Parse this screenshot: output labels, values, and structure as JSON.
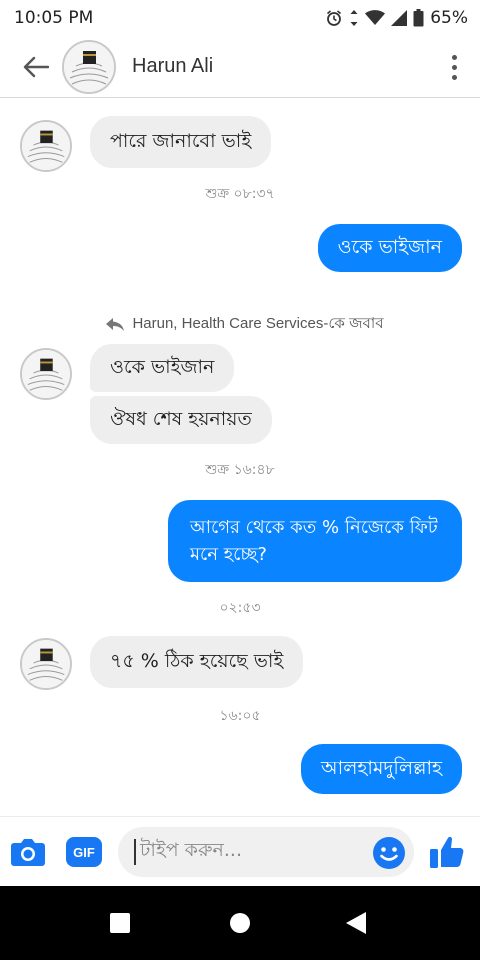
{
  "status_bar": {
    "time": "10:05 PM",
    "battery": "65%",
    "icons": [
      "alarm-icon",
      "data-arrows-icon",
      "wifi-icon",
      "signal-icon",
      "battery-icon"
    ]
  },
  "header": {
    "contact_name": "Harun Ali",
    "back_icon": "arrow-left-icon",
    "menu_icon": "more-vertical-icon"
  },
  "messages": [
    {
      "type": "incoming",
      "text": "পারে জানাবো ভাই"
    },
    {
      "type": "time",
      "text": "শুক্র ০৮:৩৭"
    },
    {
      "type": "outgoing",
      "text": "ওকে ভাইজান"
    },
    {
      "type": "reply_note",
      "text": "Harun, Health Care Services-কে জবাব"
    },
    {
      "type": "incoming",
      "text": "ওকে ভাইজান"
    },
    {
      "type": "incoming",
      "text": "ঔষধ শেষ হয়নায়ত"
    },
    {
      "type": "time",
      "text": "শুক্র ১৬:৪৮"
    },
    {
      "type": "outgoing",
      "text": "আগের থেকে কত % নিজেকে ফিট মনে হচ্ছে?"
    },
    {
      "type": "time",
      "text": "০২:৫৩"
    },
    {
      "type": "incoming",
      "text": "৭৫ % ঠিক হয়েছে ভাই"
    },
    {
      "type": "time",
      "text": "১৬:০৫"
    },
    {
      "type": "outgoing",
      "text": "আলহামদুলিল্লাহ"
    }
  ],
  "composer": {
    "placeholder": "টাইপ করুন...",
    "gif_label": "GIF",
    "camera_icon": "camera-icon",
    "emoji_icon": "emoji-icon",
    "like_icon": "thumbs-up-icon"
  },
  "colors": {
    "outgoing_bubble": "#0a84ff",
    "incoming_bubble": "#eeeeee",
    "accent": "#1877f2"
  }
}
